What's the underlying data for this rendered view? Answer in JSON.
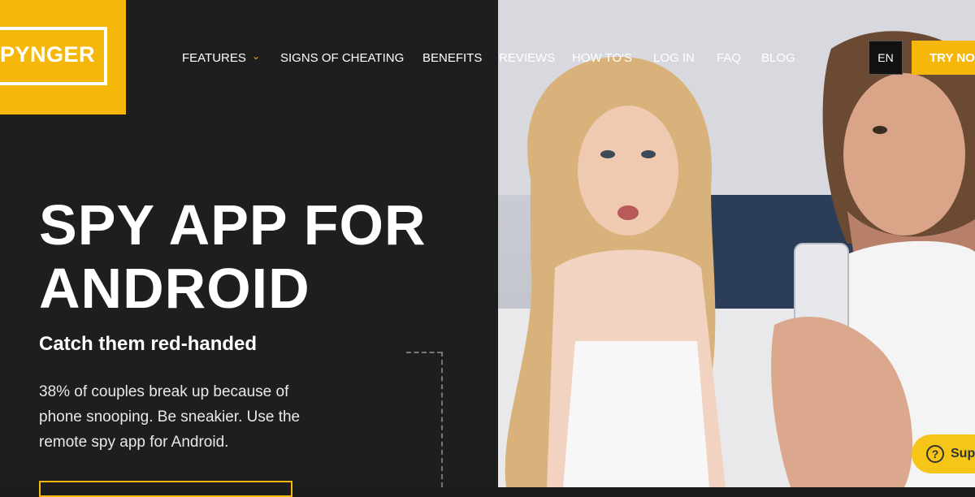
{
  "brand": {
    "logo_text": "PYNGER"
  },
  "nav": {
    "items": [
      "FEATURES",
      "SIGNS OF CHEATING",
      "BENEFITS",
      "REVIEWS",
      "HOW TO'S",
      "LOG IN",
      "FAQ",
      "BLOG"
    ],
    "chevron": "⌄",
    "lang": "EN",
    "cta": "TRY NO"
  },
  "hero": {
    "title_line1": "SPY APP FOR",
    "title_line2": "ANDROID",
    "subtitle": "Catch them red-handed",
    "body_line1": "38% of couples break up because of",
    "body_line2": "phone snooping. Be sneakier. Use the",
    "body_line3": "remote spy app for Android."
  },
  "support": {
    "label": "Sup",
    "icon": "?"
  },
  "colors": {
    "accent": "#f5b70a",
    "bg": "#1e1e1e"
  }
}
